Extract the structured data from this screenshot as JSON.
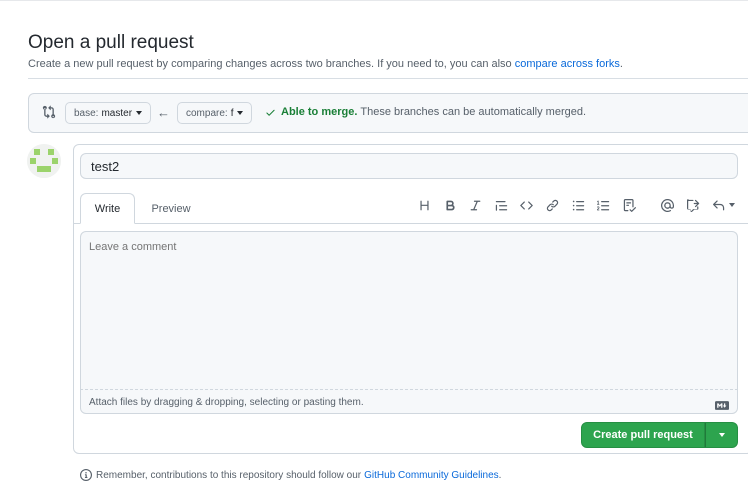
{
  "page": {
    "title": "Open a pull request",
    "subtitle": "Create a new pull request by comparing changes across two branches. If you need to, you can also",
    "subtitle_link": "compare across forks",
    "subtitle_end": "."
  },
  "range": {
    "base_prefix": "base:",
    "base_value": "master",
    "compare_prefix": "compare:",
    "compare_value": "f",
    "merge_status": "Able to merge.",
    "merge_detail": "These branches can be automatically merged."
  },
  "form": {
    "title_value": "test2",
    "tabs": [
      {
        "label": "Write"
      },
      {
        "label": "Preview"
      }
    ],
    "toolbar_icons": [
      "heading-icon",
      "bold-icon",
      "italic-icon",
      "quote-icon",
      "code-icon",
      "link-icon",
      "unordered-list-icon",
      "ordered-list-icon",
      "task-list-icon",
      "mention-icon",
      "reference-icon",
      "reply-icon"
    ],
    "comment_placeholder": "Leave a comment",
    "attach_text": "Attach files by dragging & dropping, selecting or pasting them.",
    "create_button": "Create pull request"
  },
  "footer": {
    "note": "Remember, contributions to this repository should follow our",
    "link": "GitHub Community Guidelines",
    "end": "."
  },
  "colors": {
    "accent": "#0969da",
    "success": "#2da44e",
    "merge_ok": "#1a7f37"
  }
}
